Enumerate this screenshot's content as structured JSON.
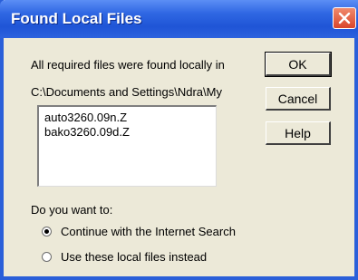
{
  "window": {
    "title": "Found Local Files"
  },
  "message": {
    "line1": "All required files were found locally in",
    "path": "C:\\Documents and Settings\\Ndra\\My"
  },
  "files": [
    "auto3260.09n.Z",
    "bako3260.09d.Z"
  ],
  "buttons": {
    "ok": "OK",
    "cancel": "Cancel",
    "help": "Help"
  },
  "question": {
    "label": "Do you want to:",
    "options": [
      {
        "label": "Continue with the Internet Search",
        "selected": true
      },
      {
        "label": "Use these local files instead",
        "selected": false
      }
    ]
  },
  "colors": {
    "titlebar": "#2f67e3",
    "close": "#d9452a",
    "dialog_bg": "#ece9d8"
  }
}
